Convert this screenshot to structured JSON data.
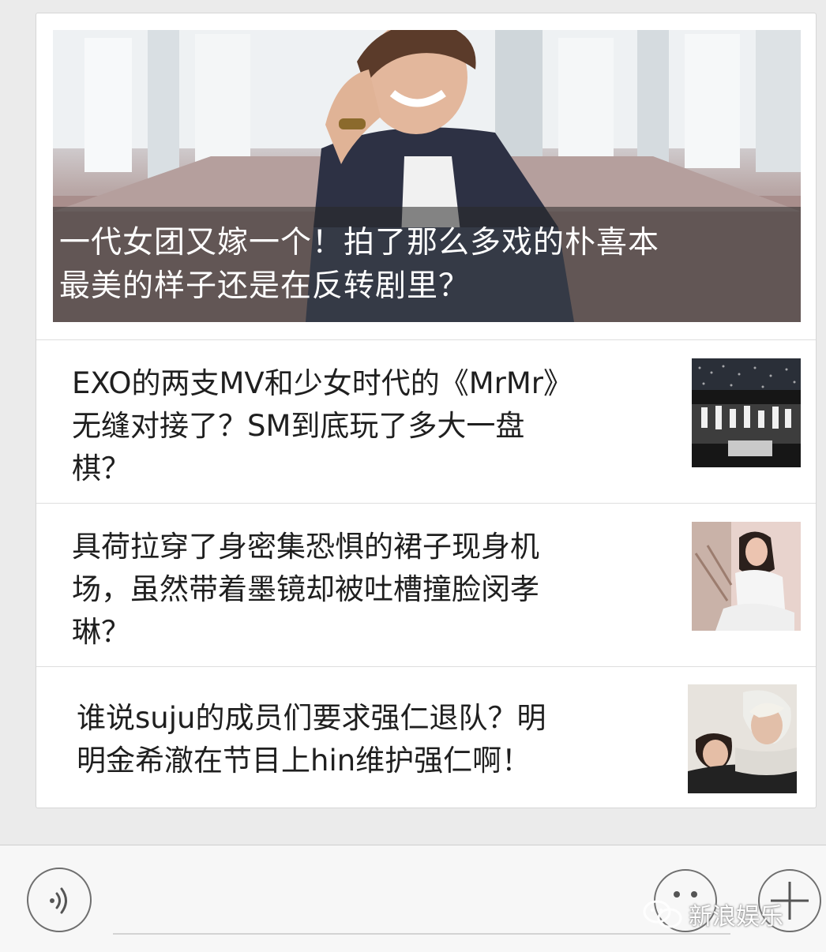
{
  "featured": {
    "title_line1": "一代女团又嫁一个！拍了那么多戏的朴喜本",
    "title_line2": "最美的样子还是在反转剧里？"
  },
  "articles": [
    {
      "title_line1": "EXO的两支MV和少女时代的《MrMr》",
      "title_line2": "无缝对接了？SM到底玩了多大一盘",
      "title_line3": "棋？"
    },
    {
      "title_line1": "具荷拉穿了身密集恐惧的裙子现身机",
      "title_line2": "场，虽然带着墨镜却被吐槽撞脸闵孝",
      "title_line3": "琳？"
    },
    {
      "title_line1": "谁说suju的成员们要求强仁退队？明",
      "title_line2": "明金希澈在节目上hin维护强仁啊！"
    }
  ],
  "watermark": {
    "text": "新浪娱乐"
  },
  "icons": {
    "voice": "voice-icon",
    "emoji": "emoji-icon",
    "plus": "plus-icon",
    "wechat": "wechat-logo-icon"
  }
}
